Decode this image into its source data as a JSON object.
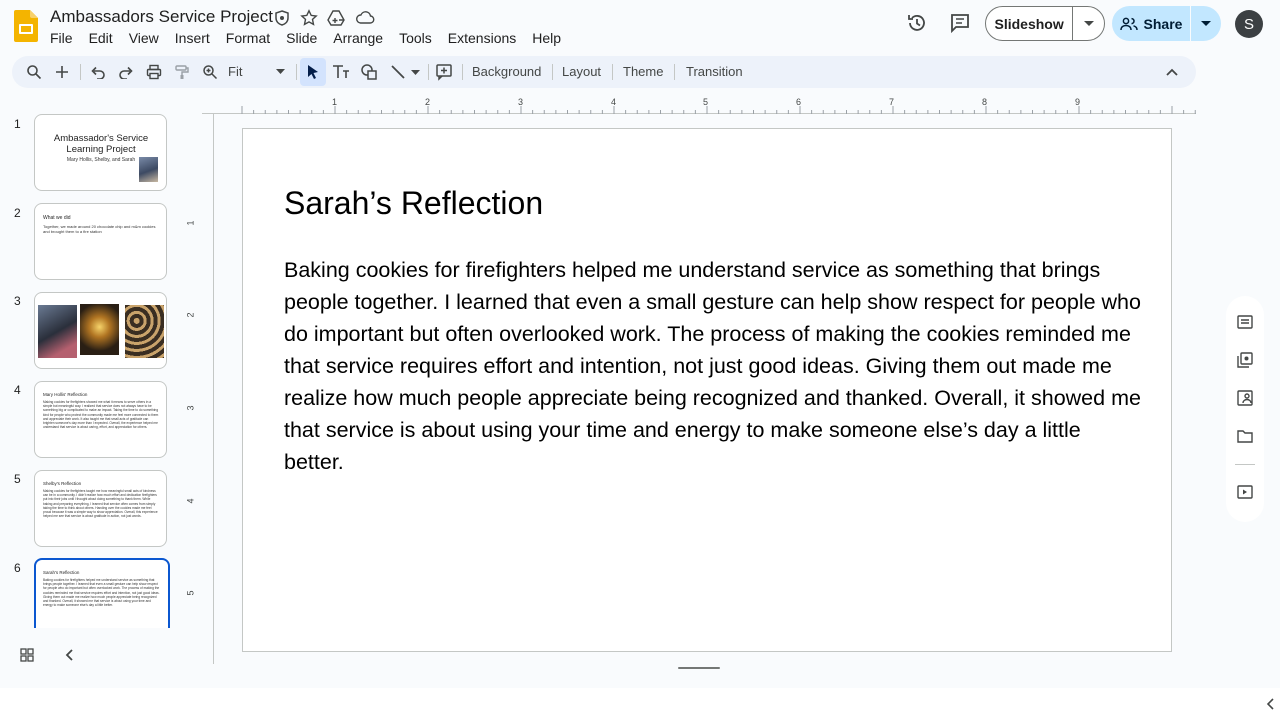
{
  "header": {
    "title": "Ambassadors Service Project",
    "menu": [
      "File",
      "Edit",
      "View",
      "Insert",
      "Format",
      "Slide",
      "Arrange",
      "Tools",
      "Extensions",
      "Help"
    ],
    "slideshow_label": "Slideshow",
    "share_label": "Share",
    "avatar_initial": "S"
  },
  "toolbar": {
    "zoom": "Fit",
    "buttons": [
      "Background",
      "Layout",
      "Theme",
      "Transition"
    ]
  },
  "filmstrip": {
    "slides": [
      {
        "num": "1",
        "title": "Ambassador's Service Learning Project",
        "subtitle": "Mary Hollis, Shelby, and Sarah"
      },
      {
        "num": "2",
        "title": "What we did",
        "body": "Together, we made around 20 chocolate chip and m&m cookies and brought them to a fire station"
      },
      {
        "num": "3"
      },
      {
        "num": "4",
        "title": "Mary Hollis' Reflection",
        "body": "Making cookies for firefighters showed me what it means to serve others in a simple but meaningful way. I realized that service does not always have to be something big or complicated to make an impact. Taking the time to do something kind for people who protect the community made me feel more connected to them and appreciate their work. It also taught me that small acts of gratitude can brighten someone's day more than I expected. Overall, the experience helped me understand that service is about caring, effort, and appreciation for others."
      },
      {
        "num": "5",
        "title": "Shelby's Reflection",
        "body": "Making cookies for firefighters taught me how meaningful small acts of kindness can be in a community. I didn't realize how much effort and dedication firefighters put into their jobs until I thought about doing something to thank them. While baking and preparing everything, I learned that service often comes from simply taking the time to think about others. Handing over the cookies made me feel proud because it was a simple way to show appreciation. Overall, this experience helped me see that service is about gratitude in action, not just words."
      },
      {
        "num": "6",
        "title": "Sarah's Reflection",
        "body": "Baking cookies for firefighters helped me understand service as something that brings people together. I learned that even a small gesture can help show respect for people who do important but often overlooked work. The process of making the cookies reminded me that service requires effort and intention, not just good ideas. Giving them out made me realize how much people appreciate being recognized and thanked. Overall, it showed me that service is about using your time and energy to make someone else's day a little better."
      }
    ]
  },
  "rulers": {
    "top": [
      "1",
      "2",
      "3",
      "4",
      "5",
      "6",
      "7",
      "8",
      "9"
    ],
    "left": [
      "1",
      "2",
      "3",
      "4",
      "5"
    ]
  },
  "slide": {
    "title": "Sarah’s Reflection",
    "body": "Baking cookies for firefighters helped me understand service as something that brings people together. I learned that even a small gesture can help show respect for people who do important but often overlooked work. The process of making the cookies reminded me that service requires effort and intention, not just good ideas. Giving them out made me realize how much people appreciate being recognized and thanked. Overall, it showed me that service is about using your time and energy to make someone else’s day a little better."
  },
  "colors": {
    "accent": "#0b57d0",
    "share_bg": "#c2e7ff",
    "toolbar_bg": "#edf2fa",
    "logo": "#f4b400"
  }
}
